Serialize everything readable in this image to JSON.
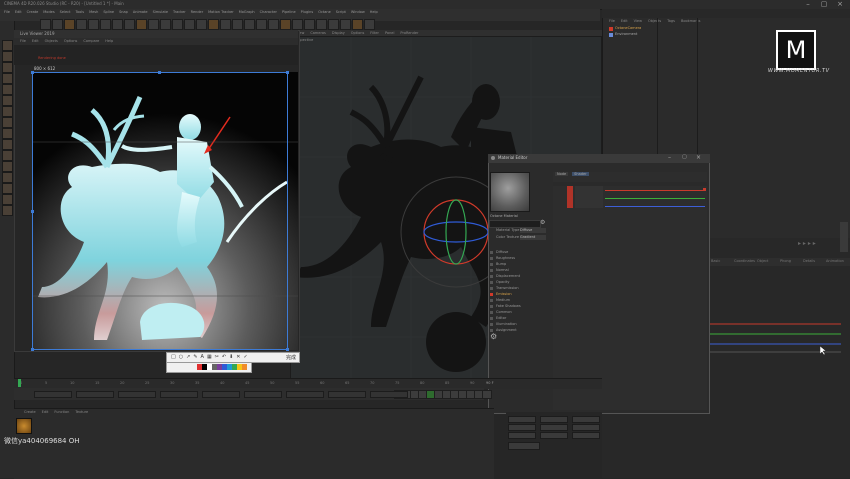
{
  "app": {
    "title": "CINEMA 4D R20.026 Studio (RC - R20) - [Untitled 1 *] - Main",
    "menu_items": [
      "File",
      "Edit",
      "Create",
      "Modes",
      "Select",
      "Tools",
      "Mesh",
      "Spline",
      "Snap",
      "Animate",
      "Simulate",
      "Tracker",
      "Render",
      "Motion Tracker",
      "MoGraph",
      "Character",
      "Pipeline",
      "Plugins",
      "Octane",
      "Script",
      "Window",
      "Help"
    ]
  },
  "render_window": {
    "title": "Live Viewer 2019",
    "menu": [
      "File",
      "Edit",
      "Objects",
      "Options",
      "Compare",
      "Help"
    ],
    "size_label": "800 × 612",
    "status_text": "Rendering done"
  },
  "viewport": {
    "menu": [
      "View",
      "Cameras",
      "Display",
      "Options",
      "Filter",
      "Panel",
      "ProRender"
    ],
    "label": "Perspective"
  },
  "object_manager": {
    "menu": [
      "File",
      "Edit",
      "View",
      "Objects",
      "Tags",
      "Bookmarks"
    ],
    "items": [
      "OctaneCamera",
      "Environment"
    ]
  },
  "logo": {
    "letter": "M",
    "url": "WWW.MOMENTOR.TV"
  },
  "material_editor": {
    "title": "Material Editor",
    "mat_name": "Octane Material",
    "channels": [
      "Diffuse",
      "Roughness",
      "Bump",
      "Normal",
      "Displacement",
      "Opacity",
      "Transmission",
      "Emission",
      "Medium",
      "Fake Shadows",
      "Common",
      "Editor",
      "Illumination",
      "Assignment"
    ],
    "active_channel": "Emission",
    "tabs": [
      "Node",
      "Shader"
    ],
    "field_labels": [
      "Material Type",
      "Color Texture"
    ],
    "field_values": [
      "Diffuse",
      "Gradient"
    ]
  },
  "attributes_tabs": [
    "Basic",
    "Coordinates",
    "Object",
    "Phong",
    "Details",
    "Animation"
  ],
  "timeline": {
    "frames": [
      "0",
      "5",
      "10",
      "15",
      "20",
      "25",
      "30",
      "35",
      "40",
      "45",
      "50",
      "55",
      "60",
      "65",
      "70",
      "75",
      "80",
      "85",
      "90"
    ],
    "end_frame": "90 F"
  },
  "bottom_tabs": [
    "Create",
    "Edit",
    "Function",
    "Texture"
  ],
  "watermark_text": "微信ya404069684 OH",
  "screenshot_tool": {
    "done_label": "完成",
    "swatches": [
      "#e03030",
      "#000000",
      "#ffffff",
      "#666666",
      "#7a3d9a",
      "#2f5bd6",
      "#1e9bd6",
      "#34a853",
      "#f5c518",
      "#f08c2a"
    ]
  },
  "colors": {
    "selection": "#3d7bd6",
    "accent_red": "#d13a2a",
    "arrow_red": "#e32b1e"
  }
}
